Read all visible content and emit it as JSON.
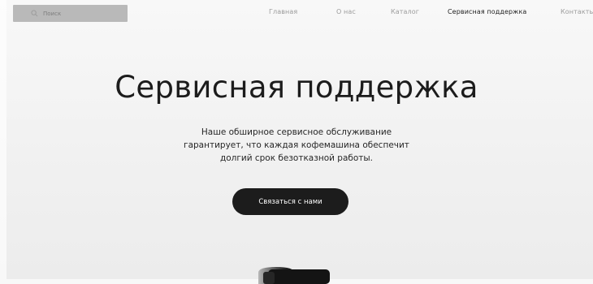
{
  "search": {
    "placeholder": "Поиск",
    "icon": "search-icon"
  },
  "nav": {
    "items": [
      {
        "label": "Главная",
        "active": false
      },
      {
        "label": "О нас",
        "active": false
      },
      {
        "label": "Каталог",
        "active": false
      },
      {
        "label": "Сервисная поддержка",
        "active": true
      },
      {
        "label": "Контакты",
        "active": false
      }
    ]
  },
  "hero": {
    "title": "Сервисная поддержка",
    "subtitle_lines": [
      "Наше обширное сервисное обслуживание",
      "гарантирует, что каждая кофемашина обеспечит",
      "долгий срок безотказной работы."
    ],
    "cta_label": "Связаться с нами"
  },
  "colors": {
    "background": "#f4f4f4",
    "text": "#1c1c1c",
    "nav_inactive": "#9b9b9b",
    "search_bg": "#b9b9b9",
    "button_bg": "#1c1c1c",
    "button_text": "#ffffff"
  }
}
